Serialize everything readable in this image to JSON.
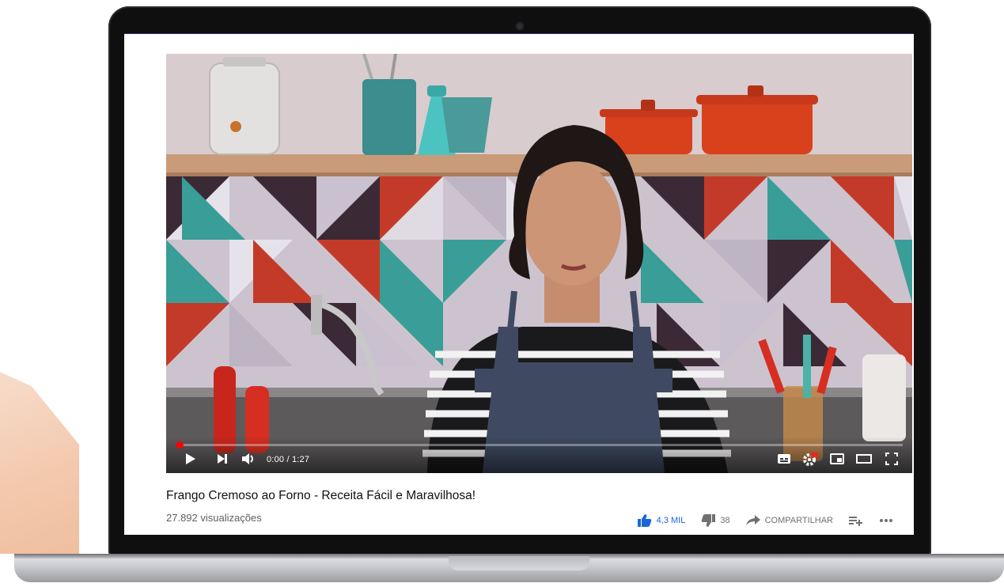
{
  "video": {
    "time_display": "0:00 / 1:27",
    "progress": 0.005,
    "title": "Frango Cremoso ao Forno - Receita Fácil e Maravilhosa!",
    "views": "27.892 visualizações"
  },
  "controls": {
    "icons": [
      "play-icon",
      "next-icon",
      "volume-icon",
      "subtitles-icon",
      "settings-icon",
      "miniplayer-icon",
      "theater-mode-icon",
      "fullscreen-icon"
    ]
  },
  "actions": {
    "likes": "4,3 MIL",
    "dislikes": "38",
    "share": "COMPARTILHAR"
  },
  "colors": {
    "like_blue": "#1a66d6",
    "progress_red": "#ff0000",
    "pot_red": "#d9401c",
    "teal": "#3a9e98"
  }
}
